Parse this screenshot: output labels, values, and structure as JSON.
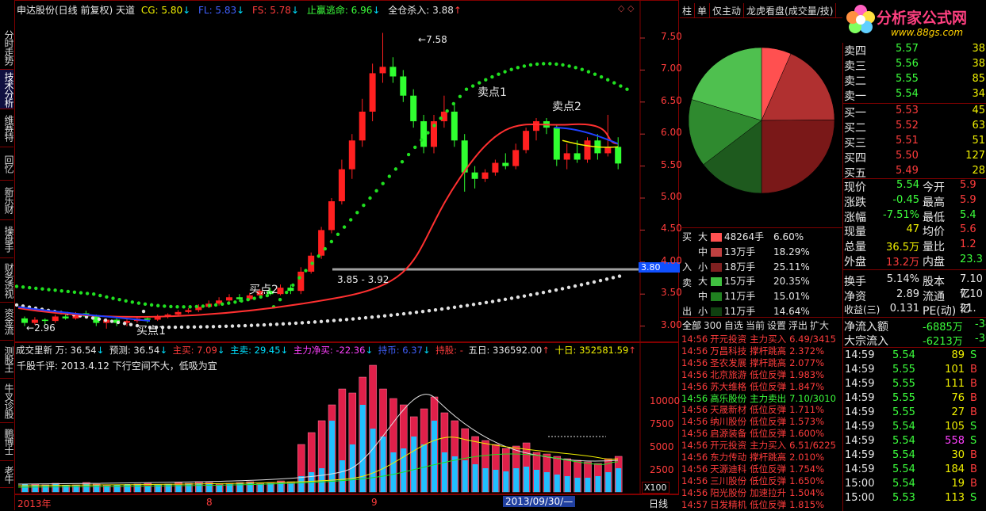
{
  "sidebar": [
    {
      "label": "分时走势"
    },
    {
      "label": "技术分析",
      "active": true
    },
    {
      "label": "维赛特"
    },
    {
      "label": "回忆"
    },
    {
      "label": "新乐财"
    },
    {
      "label": "操盘手"
    },
    {
      "label": "财务透视"
    },
    {
      "label": "资金流"
    },
    {
      "label": "测股王"
    },
    {
      "label": "牛叉诊股"
    },
    {
      "label": "鹏博士"
    },
    {
      "label": "老牛"
    }
  ],
  "header": {
    "title": "申达股份(日线 前复权) 天道",
    "cg": "CG: 5.80",
    "fl": "FL: 5.83",
    "fs": "FS: 5.78",
    "zy": "止赢逃命: 6.96",
    "qc": "全仓杀入: 3.88"
  },
  "annotations": {
    "high": "7.58",
    "low": "2.96",
    "sell1": "卖点1",
    "sell2": "卖点2",
    "buy1": "买点1",
    "buy2": "买点2",
    "range": "3.85 - 3.92",
    "price_tag": "3.80"
  },
  "price_axis": [
    "7.50",
    "7.00",
    "6.50",
    "6.00",
    "5.50",
    "5.00",
    "4.50",
    "4.00",
    "3.50",
    "3.00"
  ],
  "volume_header": {
    "name": "成交里新 万: 36.54",
    "pred": "预测: 36.54",
    "buy": "主买: 7.09",
    "sell": "主卖: 29.45",
    "net": "主力净买: -22.36",
    "hold": "持币: 6.37",
    "holdstock": "持股: -",
    "d5": "五日: 336592.00",
    "d10": "十日: 352581.59"
  },
  "comment": "千股千评: 2013.4.12 下行空间不大，低吸为宜",
  "vol_axis": [
    "10000",
    "7500",
    "5000",
    "2500"
  ],
  "vol_unit": "X100",
  "date_axis": {
    "left": "2013年",
    "m8": "8",
    "m9": "9",
    "cursor": "2013/09/30/—",
    "period": "日线"
  },
  "right_tabs": [
    "柱",
    "单",
    "仅主动",
    "龙虎看盘(成交量/技)"
  ],
  "logo": {
    "name": "分析家公式网",
    "url": "www.88gs.com"
  },
  "flow": {
    "buy_label": "买",
    "in_label": "入",
    "sell_label": "卖",
    "out_label": "出",
    "rows": [
      {
        "size": "大",
        "amount": "48264手",
        "pct": "6.60%",
        "color": "#ff5050"
      },
      {
        "size": "中",
        "amount": "13万手",
        "pct": "18.29%",
        "color": "#c04040"
      },
      {
        "size": "小",
        "amount": "18万手",
        "pct": "25.11%",
        "color": "#802020"
      },
      {
        "size": "大",
        "amount": "15万手",
        "pct": "20.35%",
        "color": "#40c040"
      },
      {
        "size": "中",
        "amount": "11万手",
        "pct": "15.01%",
        "color": "#208020"
      },
      {
        "size": "小",
        "amount": "11万手",
        "pct": "14.64%",
        "color": "#104010"
      }
    ]
  },
  "bottom_tabs": [
    "全部",
    "300",
    "自选",
    "当前",
    "设置",
    "浮出",
    "扩大"
  ],
  "news": [
    {
      "time": "14:56",
      "name": "开元投资",
      "event": "主力买入",
      "val": "6.49/3415",
      "c": "red"
    },
    {
      "time": "14:56",
      "name": "万昌科技",
      "event": "撑杆跳高",
      "val": "2.372%",
      "c": "red"
    },
    {
      "time": "14:56",
      "name": "圣农发展",
      "event": "撑杆跳高",
      "val": "2.077%",
      "c": "red"
    },
    {
      "time": "14:56",
      "name": "北京旅游",
      "event": "低位反弹",
      "val": "1.983%",
      "c": "red"
    },
    {
      "time": "14:56",
      "name": "苏大维格",
      "event": "低位反弹",
      "val": "1.847%",
      "c": "red"
    },
    {
      "time": "14:56",
      "name": "高乐股份",
      "event": "主力卖出",
      "val": "7.10/3010",
      "c": "green"
    },
    {
      "time": "14:56",
      "name": "天晟新材",
      "event": "低位反弹",
      "val": "1.711%",
      "c": "red"
    },
    {
      "time": "14:56",
      "name": "纳川股份",
      "event": "低位反弹",
      "val": "1.573%",
      "c": "red"
    },
    {
      "time": "14:56",
      "name": "启源装备",
      "event": "低位反弹",
      "val": "1.600%",
      "c": "red"
    },
    {
      "time": "14:56",
      "name": "开元投资",
      "event": "主力买入",
      "val": "6.51/6225",
      "c": "red"
    },
    {
      "time": "14:56",
      "name": "东力传动",
      "event": "撑杆跳高",
      "val": "2.010%",
      "c": "red"
    },
    {
      "time": "14:56",
      "name": "天源迪科",
      "event": "低位反弹",
      "val": "1.754%",
      "c": "red"
    },
    {
      "time": "14:56",
      "name": "三川股份",
      "event": "低位反弹",
      "val": "1.650%",
      "c": "red"
    },
    {
      "time": "14:56",
      "name": "阳光股份",
      "event": "加速拉升",
      "val": "1.504%",
      "c": "red"
    },
    {
      "time": "14:57",
      "name": "日发精机",
      "event": "低位反弹",
      "val": "1.815%",
      "c": "red"
    }
  ],
  "orderbook": [
    {
      "label": "卖四",
      "price": "5.57",
      "vol": "38"
    },
    {
      "label": "卖三",
      "price": "5.56",
      "vol": "38"
    },
    {
      "label": "卖二",
      "price": "5.55",
      "vol": "85"
    },
    {
      "label": "卖一",
      "price": "5.54",
      "vol": "34"
    },
    {
      "label": "买一",
      "price": "5.53",
      "vol": "45"
    },
    {
      "label": "买二",
      "price": "5.52",
      "vol": "63"
    },
    {
      "label": "买三",
      "price": "5.51",
      "vol": "51"
    },
    {
      "label": "买四",
      "price": "5.50",
      "vol": "127"
    },
    {
      "label": "买五",
      "price": "5.49",
      "vol": "28"
    }
  ],
  "quote": [
    {
      "k1": "现价",
      "v1": "5.54",
      "k2": "今开",
      "v2": "5.9"
    },
    {
      "k1": "涨跌",
      "v1": "-0.45",
      "k2": "最高",
      "v2": "5.9"
    },
    {
      "k1": "涨幅",
      "v1": "-7.51%",
      "k2": "最低",
      "v2": "5.4"
    },
    {
      "k1": "现量",
      "v1": "47",
      "k2": "均价",
      "v2": "5.6"
    },
    {
      "k1": "总量",
      "v1": "36.5万",
      "k2": "量比",
      "v2": "1.2"
    },
    {
      "k1": "外盘",
      "v1": "13.2万",
      "k2": "内盘",
      "v2": "23.3"
    },
    {
      "k1": "换手",
      "v1": "5.14%",
      "k2": "股本",
      "v2": "7.10亿"
    },
    {
      "k1": "净资",
      "v1": "2.89",
      "k2": "流通",
      "v2": "7.10亿"
    },
    {
      "k1": "收益(三)",
      "v1": "0.131",
      "k2": "PE(动)",
      "v2": "21."
    }
  ],
  "netflow": [
    {
      "k": "净流入额",
      "v": "-6885万",
      "v2": "-34"
    },
    {
      "k": "大宗流入",
      "v": "-6213万",
      "v2": "-30"
    }
  ],
  "ticks": [
    {
      "t": "14:59",
      "p": "5.54",
      "v": "89",
      "s": "S"
    },
    {
      "t": "14:59",
      "p": "5.55",
      "v": "101",
      "s": "B"
    },
    {
      "t": "14:59",
      "p": "5.55",
      "v": "111",
      "s": "B"
    },
    {
      "t": "14:59",
      "p": "5.55",
      "v": "76",
      "s": "B"
    },
    {
      "t": "14:59",
      "p": "5.55",
      "v": "27",
      "s": "B"
    },
    {
      "t": "14:59",
      "p": "5.54",
      "v": "105",
      "s": "S"
    },
    {
      "t": "14:59",
      "p": "5.54",
      "v": "558",
      "s": "S"
    },
    {
      "t": "14:59",
      "p": "5.54",
      "v": "30",
      "s": "B"
    },
    {
      "t": "14:59",
      "p": "5.54",
      "v": "184",
      "s": "B"
    },
    {
      "t": "15:00",
      "p": "5.54",
      "v": "19",
      "s": "B"
    },
    {
      "t": "15:00",
      "p": "5.53",
      "v": "113",
      "s": "S"
    }
  ],
  "pie": [
    {
      "name": "大买",
      "value": 6.6,
      "color": "#ff5050"
    },
    {
      "name": "中买",
      "value": 18.29,
      "color": "#b03030"
    },
    {
      "name": "小买",
      "value": 25.11,
      "color": "#7a1818"
    },
    {
      "name": "小卖",
      "value": 14.64,
      "color": "#1e5a1e"
    },
    {
      "name": "中卖",
      "value": 15.01,
      "color": "#2f8a2f"
    },
    {
      "name": "大卖",
      "value": 20.35,
      "color": "#4fc04f"
    }
  ]
}
